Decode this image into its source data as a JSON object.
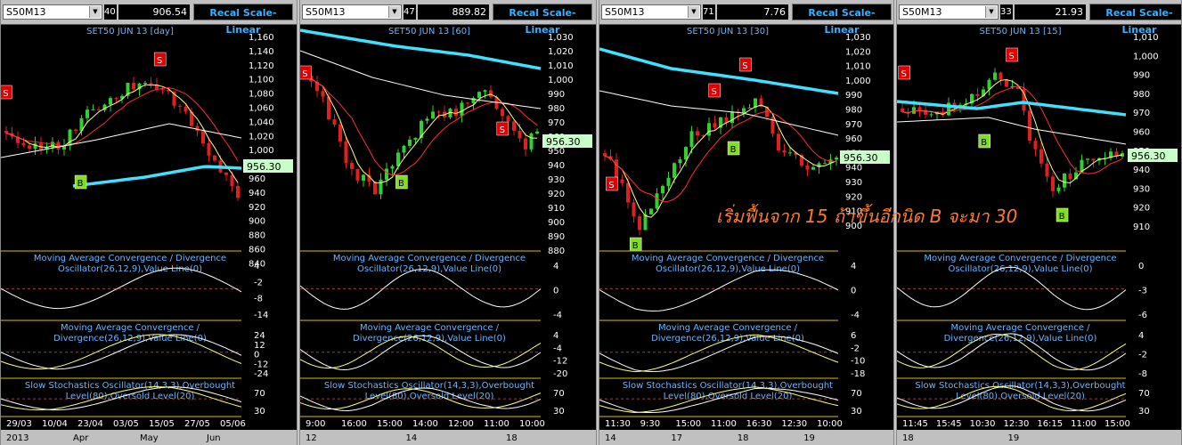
{
  "panels": [
    {
      "symbol": "S50M13",
      "count": "40",
      "price": "906.54",
      "recal_label": "Recal Scale-Linear",
      "title": "SET50 JUN 13  [day]",
      "price_label": "956.30",
      "price_axis": [
        "1,160",
        "1,140",
        "1,120",
        "1,100",
        "1,080",
        "1,060",
        "1,040",
        "1,020",
        "1,000",
        "980",
        "960",
        "940",
        "920",
        "900",
        "880",
        "860",
        "840"
      ],
      "ind1_title": [
        "Moving Average Convergence / Divergence",
        "Oscillator(26,12,9),Value Line(0)"
      ],
      "ind1_axis": [
        "4",
        "-2",
        "-8",
        "-14"
      ],
      "ind2_title": [
        "Moving Average Convergence /",
        "Divergence(26,12,9),Value Line(0)"
      ],
      "ind2_axis": [
        "24",
        "12",
        "0",
        "-12",
        "-24"
      ],
      "ind3_title": [
        "Slow Stochastics Oscillator(14,3,3),Overbought",
        "Level(80),Oversold Level(20)"
      ],
      "ind3_axis": [
        "70",
        "30"
      ],
      "date_labels": [
        "29/03",
        "10/04",
        "23/04",
        "03/05",
        "15/05",
        "27/05",
        "05/06"
      ],
      "period_labels": [
        "2013",
        "Apr",
        "May",
        "Jun"
      ],
      "signals": [
        "S",
        "S",
        "B"
      ]
    },
    {
      "symbol": "S50M13",
      "count": "47",
      "price": "889.82",
      "recal_label": "Recal Scale-Linear",
      "title": "SET50 JUN 13  [60]",
      "price_label": "956.30",
      "price_axis": [
        "1,030",
        "1,020",
        "1,010",
        "1,000",
        "990",
        "980",
        "970",
        "960",
        "950",
        "940",
        "930",
        "920",
        "910",
        "900",
        "890",
        "880"
      ],
      "ind1_title": [
        "Moving Average Convergence / Divergence",
        "Oscillator(26,12,9),Value Line(0)"
      ],
      "ind1_axis": [
        "4",
        "0",
        "-4"
      ],
      "ind2_title": [
        "Moving Average Convergence /",
        "Divergence(26,12,9),Value Line(0)"
      ],
      "ind2_axis": [
        "4",
        "-4",
        "-12",
        "-20"
      ],
      "ind3_title": [
        "Slow Stochastics Oscillator(14,3,3),Overbought",
        "Level(80),Oversold Level(20)"
      ],
      "ind3_axis": [
        "70",
        "30"
      ],
      "date_labels": [
        "9:00",
        "16:00",
        "15:00",
        "14:00",
        "12:00",
        "11:00",
        "10:00"
      ],
      "period_labels": [
        "12",
        "14",
        "18"
      ],
      "signals": [
        "S",
        "S",
        "B"
      ]
    },
    {
      "symbol": "S50M13",
      "count": "71",
      "price": "7.76",
      "recal_label": "Recal Scale-Linear",
      "title": "SET50 JUN 13  [30]",
      "price_label": "956.30",
      "price_axis": [
        "1,030",
        "1,020",
        "1,010",
        "1,000",
        "990",
        "980",
        "970",
        "960",
        "950",
        "940",
        "930",
        "920",
        "910",
        "900"
      ],
      "ind1_title": [
        "Moving Average Convergence / Divergence",
        "Oscillator(26,12,9),Value Line(0)"
      ],
      "ind1_axis": [
        "4",
        "0",
        "-4"
      ],
      "ind2_title": [
        "Moving Average Convergence /",
        "Divergence(26,12,9),Value Line(0)"
      ],
      "ind2_axis": [
        "6",
        "-2",
        "-10",
        "-18"
      ],
      "ind3_title": [
        "Slow Stochastics Oscillator(14,3,3),Overbought",
        "Level(80),Oversold Level(20)"
      ],
      "ind3_axis": [
        "70",
        "30"
      ],
      "date_labels": [
        "11:30",
        "9:30",
        "15:00",
        "11:00",
        "16:30",
        "12:30",
        "10:00"
      ],
      "period_labels": [
        "14",
        "17",
        "18",
        "19"
      ],
      "signals": [
        "S",
        "S",
        "S",
        "B",
        "B"
      ]
    },
    {
      "symbol": "S50M13",
      "count": "33",
      "price": "21.93",
      "recal_label": "Recal Scale-Linear",
      "title": "SET50 JUN 13  [15]",
      "price_label": "956.30",
      "price_axis": [
        "1,010",
        "1,000",
        "990",
        "980",
        "970",
        "960",
        "950",
        "940",
        "930",
        "920",
        "910"
      ],
      "ind1_title": [
        "Moving Average Convergence / Divergence",
        "Oscillator(26,12,9),Value Line(0)"
      ],
      "ind1_axis": [
        "0",
        "-3",
        "-6"
      ],
      "ind2_title": [
        "Moving Average Convergence /",
        "Divergence(26,12,9),Value Line(0)"
      ],
      "ind2_axis": [
        "4",
        "-2",
        "-8"
      ],
      "ind3_title": [
        "Slow Stochastics Oscillator(14,3,3),Overbought",
        "Level(80),Oversold Level(20)"
      ],
      "ind3_axis": [
        "70",
        "30"
      ],
      "date_labels": [
        "11:45",
        "15:45",
        "10:30",
        "12:30",
        "16:15",
        "11:00",
        "15:00"
      ],
      "period_labels": [
        "18",
        "19"
      ],
      "signals": [
        "S",
        "S",
        "B",
        "B"
      ]
    }
  ],
  "overlay_text": "เริ่มฟื้นจาก 15 ถ้าขึ้นอีกนิด B จะมา 30",
  "colors": {
    "ma_long": "#40e0ff",
    "ma_fast": "#ffff80",
    "ma_mid": "#ff3030",
    "ma_slow": "#ffffff",
    "candle_up": "#30d030",
    "candle_down": "#e02020",
    "axis_text": "#ffffff",
    "title_text": "#6ab4ff",
    "divider": "#d8c000",
    "sell_box": "#e00000",
    "buy_box": "#80e020"
  }
}
